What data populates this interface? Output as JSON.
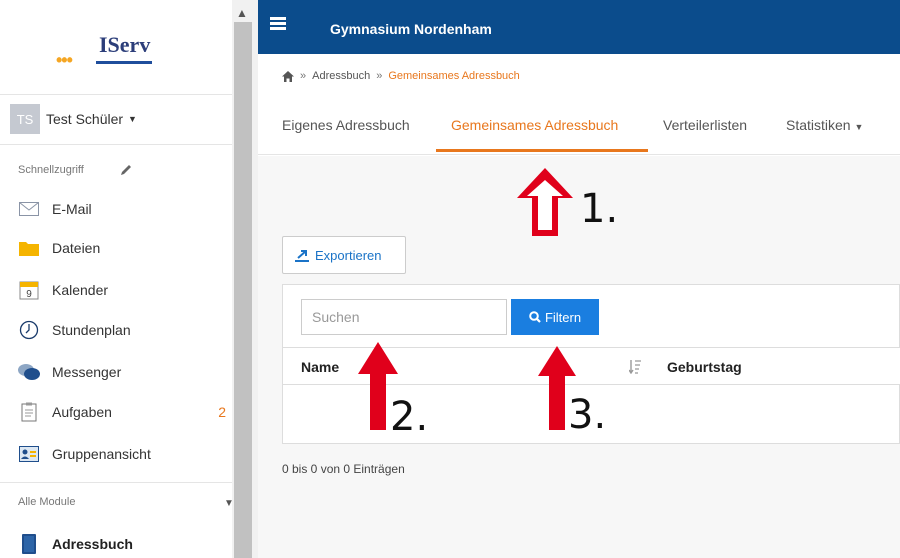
{
  "app": {
    "logo_text": "IServ",
    "school_name": "Gymnasium Nordenham"
  },
  "user": {
    "initials": "TS",
    "name": "Test Schüler"
  },
  "sidebar": {
    "quick_access_label": "Schnellzugriff",
    "items": [
      {
        "label": "E-Mail",
        "icon": "envelope-icon"
      },
      {
        "label": "Dateien",
        "icon": "folder-icon"
      },
      {
        "label": "Kalender",
        "icon": "calendar-icon",
        "calendar_day": "9"
      },
      {
        "label": "Stundenplan",
        "icon": "clock-icon"
      },
      {
        "label": "Messenger",
        "icon": "chat-bubbles-icon"
      },
      {
        "label": "Aufgaben",
        "icon": "clipboard-icon",
        "badge": "2"
      },
      {
        "label": "Gruppenansicht",
        "icon": "group-card-icon"
      }
    ],
    "all_modules_label": "Alle Module",
    "active_module": {
      "label": "Adressbuch",
      "icon": "address-book-icon"
    }
  },
  "breadcrumb": {
    "items": [
      "Adressbuch",
      "Gemeinsames Adressbuch"
    ],
    "separator": "»"
  },
  "tabs": [
    {
      "label": "Eigenes Adressbuch",
      "active": false
    },
    {
      "label": "Gemeinsames Adressbuch",
      "active": true
    },
    {
      "label": "Verteilerlisten",
      "active": false
    },
    {
      "label": "Statistiken",
      "active": false,
      "has_dropdown": true
    }
  ],
  "toolbar": {
    "export_label": "Exportieren"
  },
  "search": {
    "placeholder": "Suchen",
    "value": "",
    "filter_label": "Filtern"
  },
  "table": {
    "columns": [
      "Name",
      "Geburtstag"
    ],
    "rows": []
  },
  "status": {
    "entries_text": "0 bis 0 von 0 Einträgen"
  },
  "annotations": {
    "labels": [
      "1.",
      "2.",
      "3."
    ],
    "arrow_color": "#e0001b"
  },
  "colors": {
    "accent": "#e8771d",
    "topbar": "#0b4c8c",
    "primary_button": "#1a7ee0",
    "link": "#1a73c7"
  }
}
